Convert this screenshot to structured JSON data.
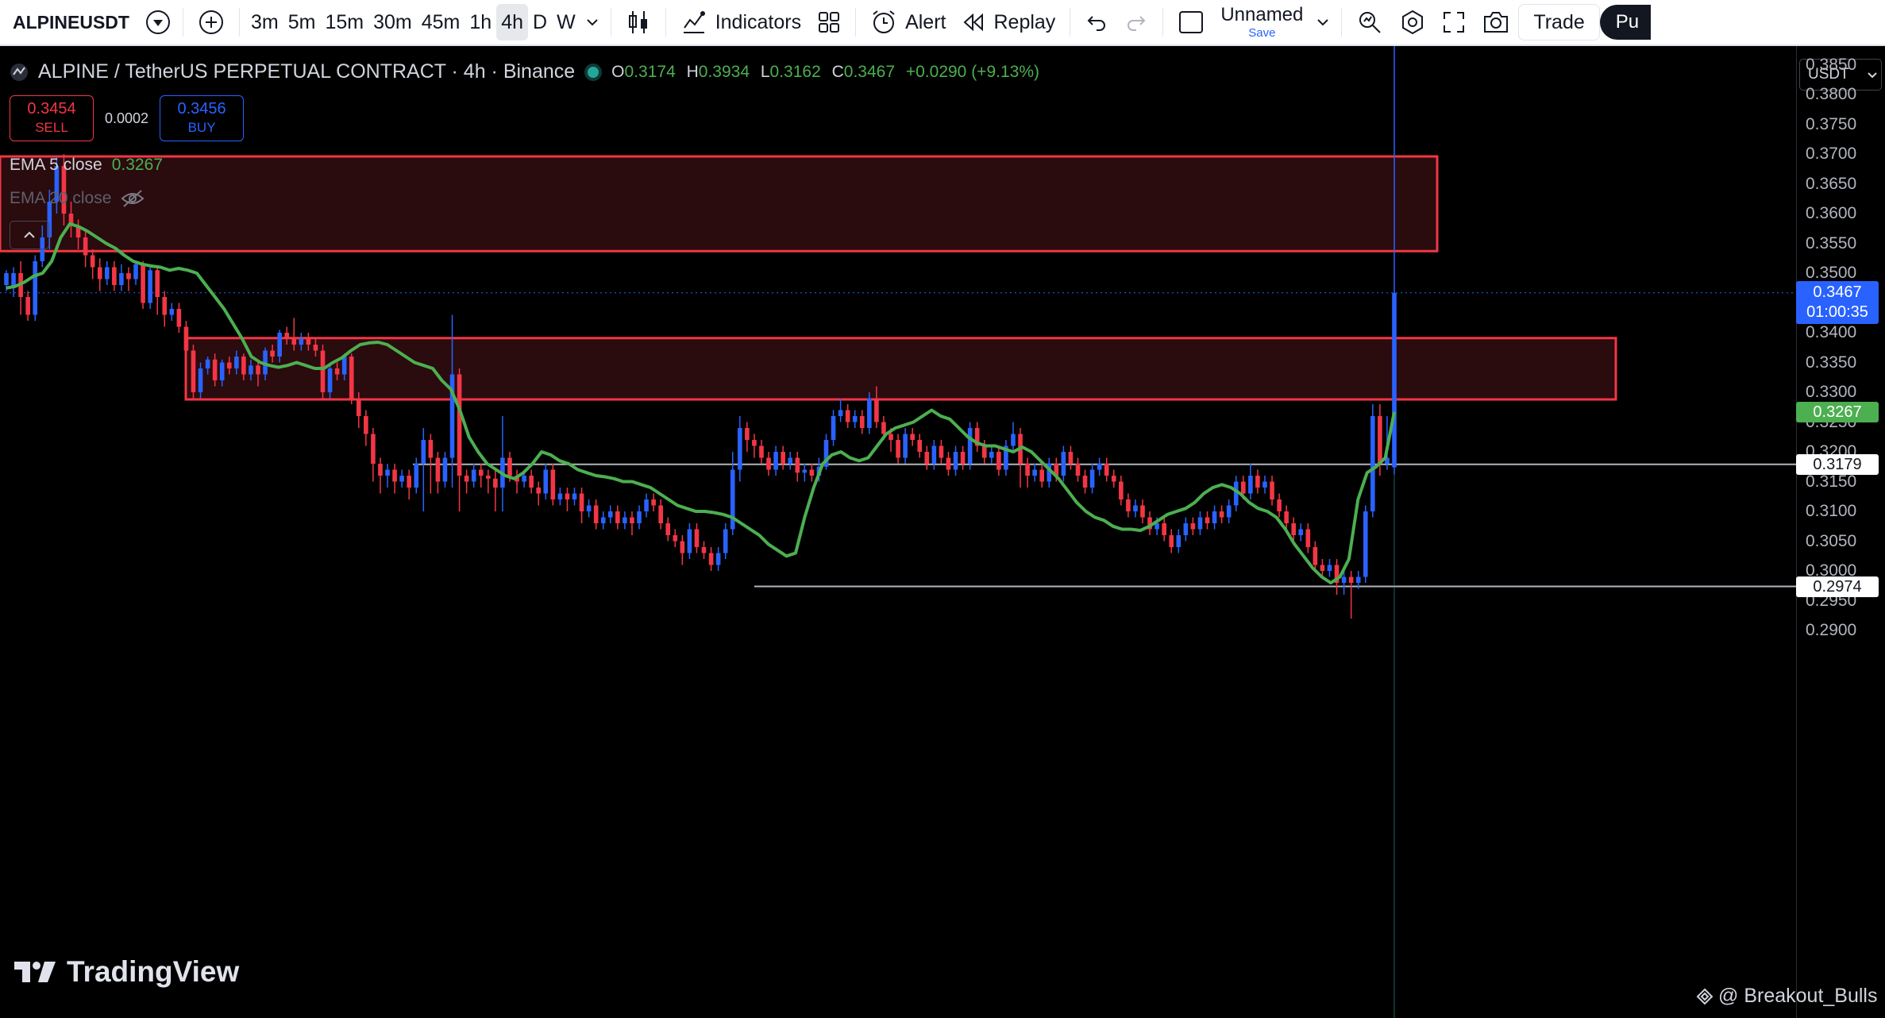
{
  "toolbar": {
    "symbol": "ALPINEUSDT",
    "intervals": [
      "3m",
      "5m",
      "15m",
      "30m",
      "45m",
      "1h",
      "4h",
      "D",
      "W"
    ],
    "active_interval": "4h",
    "indicators_label": "Indicators",
    "alert_label": "Alert",
    "replay_label": "Replay",
    "layout_name": "Unnamed",
    "layout_save": "Save",
    "trade_label": "Trade",
    "publish_label": "Pu"
  },
  "legend": {
    "title": "ALPINE / TetherUS PERPETUAL CONTRACT · 4h · Binance",
    "open_label": "O",
    "open": "0.3174",
    "high_label": "H",
    "high": "0.3934",
    "low_label": "L",
    "low": "0.3162",
    "close_label": "C",
    "close": "0.3467",
    "change": "+0.0290 (+9.13%)"
  },
  "ticket": {
    "sell_price": "0.3454",
    "sell_label": "SELL",
    "spread": "0.0002",
    "buy_price": "0.3456",
    "buy_label": "BUY"
  },
  "indicators": {
    "ema5_label": "EMA 5 close",
    "ema5_value": "0.3267",
    "ema20_label": "EMA 20 close"
  },
  "price_scale": {
    "currency": "USDT",
    "labels": [
      "0.3850",
      "0.3800",
      "0.3750",
      "0.3700",
      "0.3650",
      "0.3600",
      "0.3550",
      "0.3500",
      "0.3400",
      "0.3350",
      "0.3300",
      "0.3250",
      "0.3200",
      "0.3150",
      "0.3100",
      "0.3050",
      "0.3000",
      "0.2950",
      "0.2900"
    ],
    "last_price": "0.3467",
    "countdown": "01:00:35",
    "ema_tag": "0.3267",
    "level_1": "0.3179",
    "level_2": "0.2974"
  },
  "colors": {
    "up": "#2962ff",
    "down": "#f23645",
    "ema5": "#4caf50",
    "zone_fill": "#2a0b0e",
    "zone_border": "#f23645",
    "level_line": "#b2b5be"
  },
  "chart_data": {
    "type": "candlestick",
    "ylim": [
      0.2875,
      0.388
    ],
    "zones": [
      {
        "top": 0.3696,
        "bottom": 0.3537
      },
      {
        "top": 0.3391,
        "bottom": 0.3288
      }
    ],
    "horizontal_levels": [
      0.3179,
      0.2974
    ],
    "ema5": [
      0.3475,
      0.3478,
      0.3485,
      0.3495,
      0.35,
      0.352,
      0.356,
      0.3583,
      0.3578,
      0.357,
      0.356,
      0.355,
      0.3542,
      0.353,
      0.352,
      0.3515,
      0.3512,
      0.351,
      0.3505,
      0.3508,
      0.3505,
      0.35,
      0.348,
      0.346,
      0.344,
      0.3415,
      0.339,
      0.336,
      0.335,
      0.3345,
      0.3342,
      0.3345,
      0.335,
      0.3345,
      0.334,
      0.334,
      0.335,
      0.3358,
      0.337,
      0.338,
      0.3383,
      0.3384,
      0.338,
      0.337,
      0.336,
      0.335,
      0.3345,
      0.334,
      0.332,
      0.3305,
      0.327,
      0.3225,
      0.32,
      0.318,
      0.317,
      0.316,
      0.3155,
      0.3165,
      0.318,
      0.32,
      0.3195,
      0.3185,
      0.318,
      0.317,
      0.3165,
      0.316,
      0.3158,
      0.3155,
      0.315,
      0.315,
      0.3145,
      0.314,
      0.313,
      0.312,
      0.311,
      0.3105,
      0.31,
      0.31,
      0.3098,
      0.3095,
      0.309,
      0.308,
      0.307,
      0.306,
      0.3045,
      0.3035,
      0.3025,
      0.303,
      0.309,
      0.314,
      0.318,
      0.3195,
      0.32,
      0.319,
      0.3185,
      0.319,
      0.321,
      0.323,
      0.324,
      0.3245,
      0.325,
      0.326,
      0.327,
      0.326,
      0.3255,
      0.324,
      0.3225,
      0.3215,
      0.321,
      0.321,
      0.3205,
      0.32,
      0.3208,
      0.32,
      0.3185,
      0.317,
      0.3155,
      0.3135,
      0.3115,
      0.31,
      0.309,
      0.3085,
      0.3075,
      0.307,
      0.307,
      0.3068,
      0.3075,
      0.3085,
      0.3095,
      0.31,
      0.3105,
      0.3115,
      0.313,
      0.314,
      0.3145,
      0.314,
      0.313,
      0.3115,
      0.3105,
      0.31,
      0.309,
      0.307,
      0.3045,
      0.3025,
      0.3005,
      0.299,
      0.298,
      0.299,
      0.302,
      0.312,
      0.3165,
      0.3175,
      0.319,
      0.3267
    ],
    "candles": [
      [
        0.348,
        0.35,
        0.347,
        0.3505
      ],
      [
        0.3475,
        0.35,
        0.346,
        0.351
      ],
      [
        0.35,
        0.346,
        0.343,
        0.352
      ],
      [
        0.346,
        0.343,
        0.342,
        0.347
      ],
      [
        0.343,
        0.352,
        0.342,
        0.353
      ],
      [
        0.352,
        0.356,
        0.351,
        0.358
      ],
      [
        0.356,
        0.362,
        0.354,
        0.364
      ],
      [
        0.362,
        0.368,
        0.36,
        0.3695
      ],
      [
        0.368,
        0.36,
        0.358,
        0.37
      ],
      [
        0.36,
        0.358,
        0.356,
        0.362
      ],
      [
        0.358,
        0.356,
        0.354,
        0.359
      ],
      [
        0.356,
        0.353,
        0.351,
        0.3575
      ],
      [
        0.353,
        0.351,
        0.349,
        0.354
      ],
      [
        0.351,
        0.349,
        0.347,
        0.3525
      ],
      [
        0.349,
        0.351,
        0.348,
        0.352
      ],
      [
        0.351,
        0.348,
        0.347,
        0.352
      ],
      [
        0.348,
        0.35,
        0.347,
        0.3515
      ],
      [
        0.35,
        0.349,
        0.347,
        0.351
      ],
      [
        0.349,
        0.3515,
        0.348,
        0.352
      ],
      [
        0.3515,
        0.345,
        0.344,
        0.352
      ],
      [
        0.345,
        0.3505,
        0.344,
        0.351
      ],
      [
        0.3505,
        0.346,
        0.343,
        0.351
      ],
      [
        0.346,
        0.343,
        0.341,
        0.347
      ],
      [
        0.343,
        0.344,
        0.342,
        0.345
      ],
      [
        0.344,
        0.341,
        0.34,
        0.345
      ],
      [
        0.341,
        0.337,
        0.336,
        0.342
      ],
      [
        0.337,
        0.33,
        0.329,
        0.338
      ],
      [
        0.33,
        0.334,
        0.329,
        0.335
      ],
      [
        0.334,
        0.3355,
        0.333,
        0.336
      ],
      [
        0.3355,
        0.332,
        0.331,
        0.3365
      ],
      [
        0.332,
        0.335,
        0.331,
        0.3355
      ],
      [
        0.335,
        0.334,
        0.333,
        0.336
      ],
      [
        0.334,
        0.336,
        0.333,
        0.337
      ],
      [
        0.336,
        0.333,
        0.332,
        0.3365
      ],
      [
        0.333,
        0.3345,
        0.332,
        0.3355
      ],
      [
        0.3345,
        0.333,
        0.331,
        0.335
      ],
      [
        0.333,
        0.337,
        0.332,
        0.3375
      ],
      [
        0.337,
        0.336,
        0.335,
        0.338
      ],
      [
        0.336,
        0.34,
        0.335,
        0.3405
      ],
      [
        0.34,
        0.339,
        0.338,
        0.341
      ],
      [
        0.339,
        0.338,
        0.337,
        0.3425
      ],
      [
        0.338,
        0.339,
        0.337,
        0.34
      ],
      [
        0.339,
        0.338,
        0.337,
        0.34
      ],
      [
        0.338,
        0.337,
        0.336,
        0.339
      ],
      [
        0.337,
        0.33,
        0.329,
        0.338
      ],
      [
        0.33,
        0.334,
        0.329,
        0.335
      ],
      [
        0.334,
        0.333,
        0.332,
        0.335
      ],
      [
        0.333,
        0.336,
        0.332,
        0.3365
      ],
      [
        0.336,
        0.329,
        0.328,
        0.3365
      ],
      [
        0.329,
        0.326,
        0.324,
        0.33
      ],
      [
        0.326,
        0.323,
        0.321,
        0.327
      ],
      [
        0.323,
        0.318,
        0.315,
        0.324
      ],
      [
        0.318,
        0.316,
        0.313,
        0.319
      ],
      [
        0.316,
        0.317,
        0.314,
        0.318
      ],
      [
        0.317,
        0.315,
        0.313,
        0.318
      ],
      [
        0.315,
        0.316,
        0.314,
        0.317
      ],
      [
        0.316,
        0.314,
        0.312,
        0.317
      ],
      [
        0.314,
        0.318,
        0.313,
        0.319
      ],
      [
        0.318,
        0.322,
        0.31,
        0.324
      ],
      [
        0.322,
        0.319,
        0.313,
        0.323
      ],
      [
        0.319,
        0.315,
        0.313,
        0.32
      ],
      [
        0.315,
        0.319,
        0.314,
        0.32
      ],
      [
        0.319,
        0.333,
        0.314,
        0.343
      ],
      [
        0.333,
        0.316,
        0.31,
        0.334
      ],
      [
        0.316,
        0.315,
        0.313,
        0.317
      ],
      [
        0.315,
        0.317,
        0.314,
        0.318
      ],
      [
        0.317,
        0.316,
        0.314,
        0.318
      ],
      [
        0.316,
        0.3155,
        0.313,
        0.317
      ],
      [
        0.3155,
        0.314,
        0.31,
        0.317
      ],
      [
        0.314,
        0.319,
        0.31,
        0.326
      ],
      [
        0.319,
        0.316,
        0.315,
        0.32
      ],
      [
        0.316,
        0.315,
        0.313,
        0.317
      ],
      [
        0.315,
        0.316,
        0.314,
        0.317
      ],
      [
        0.316,
        0.314,
        0.313,
        0.317
      ],
      [
        0.314,
        0.313,
        0.311,
        0.315
      ],
      [
        0.313,
        0.317,
        0.312,
        0.318
      ],
      [
        0.317,
        0.312,
        0.311,
        0.318
      ],
      [
        0.312,
        0.313,
        0.311,
        0.314
      ],
      [
        0.313,
        0.312,
        0.31,
        0.314
      ],
      [
        0.312,
        0.313,
        0.311,
        0.314
      ],
      [
        0.313,
        0.31,
        0.308,
        0.314
      ],
      [
        0.31,
        0.311,
        0.309,
        0.312
      ],
      [
        0.311,
        0.308,
        0.307,
        0.312
      ],
      [
        0.308,
        0.309,
        0.307,
        0.31
      ],
      [
        0.309,
        0.31,
        0.308,
        0.311
      ],
      [
        0.31,
        0.308,
        0.307,
        0.311
      ],
      [
        0.308,
        0.309,
        0.307,
        0.31
      ],
      [
        0.309,
        0.308,
        0.306,
        0.31
      ],
      [
        0.308,
        0.31,
        0.307,
        0.311
      ],
      [
        0.31,
        0.312,
        0.309,
        0.313
      ],
      [
        0.312,
        0.311,
        0.31,
        0.313
      ],
      [
        0.311,
        0.308,
        0.307,
        0.312
      ],
      [
        0.308,
        0.306,
        0.305,
        0.309
      ],
      [
        0.306,
        0.305,
        0.304,
        0.307
      ],
      [
        0.305,
        0.303,
        0.301,
        0.306
      ],
      [
        0.303,
        0.307,
        0.302,
        0.308
      ],
      [
        0.307,
        0.304,
        0.303,
        0.308
      ],
      [
        0.304,
        0.303,
        0.302,
        0.305
      ],
      [
        0.303,
        0.301,
        0.3,
        0.304
      ],
      [
        0.301,
        0.303,
        0.3,
        0.304
      ],
      [
        0.303,
        0.307,
        0.302,
        0.308
      ],
      [
        0.307,
        0.317,
        0.306,
        0.32
      ],
      [
        0.317,
        0.324,
        0.315,
        0.326
      ],
      [
        0.324,
        0.322,
        0.32,
        0.325
      ],
      [
        0.322,
        0.321,
        0.319,
        0.323
      ],
      [
        0.321,
        0.319,
        0.318,
        0.322
      ],
      [
        0.319,
        0.317,
        0.316,
        0.32
      ],
      [
        0.317,
        0.32,
        0.316,
        0.321
      ],
      [
        0.32,
        0.318,
        0.317,
        0.321
      ],
      [
        0.318,
        0.319,
        0.317,
        0.32
      ],
      [
        0.319,
        0.3165,
        0.315,
        0.32
      ],
      [
        0.3165,
        0.317,
        0.315,
        0.318
      ],
      [
        0.317,
        0.316,
        0.315,
        0.318
      ],
      [
        0.316,
        0.3175,
        0.315,
        0.319
      ],
      [
        0.3175,
        0.322,
        0.317,
        0.323
      ],
      [
        0.322,
        0.326,
        0.321,
        0.327
      ],
      [
        0.326,
        0.327,
        0.325,
        0.329
      ],
      [
        0.327,
        0.325,
        0.324,
        0.328
      ],
      [
        0.325,
        0.326,
        0.324,
        0.327
      ],
      [
        0.326,
        0.324,
        0.323,
        0.327
      ],
      [
        0.324,
        0.329,
        0.323,
        0.33
      ],
      [
        0.329,
        0.325,
        0.324,
        0.331
      ],
      [
        0.325,
        0.323,
        0.322,
        0.326
      ],
      [
        0.323,
        0.322,
        0.32,
        0.324
      ],
      [
        0.322,
        0.319,
        0.318,
        0.323
      ],
      [
        0.319,
        0.323,
        0.318,
        0.324
      ],
      [
        0.323,
        0.322,
        0.321,
        0.324
      ],
      [
        0.322,
        0.32,
        0.319,
        0.323
      ],
      [
        0.32,
        0.318,
        0.317,
        0.321
      ],
      [
        0.318,
        0.321,
        0.317,
        0.322
      ],
      [
        0.321,
        0.319,
        0.318,
        0.322
      ],
      [
        0.319,
        0.317,
        0.316,
        0.32
      ],
      [
        0.317,
        0.32,
        0.316,
        0.321
      ],
      [
        0.32,
        0.318,
        0.317,
        0.321
      ],
      [
        0.318,
        0.324,
        0.317,
        0.325
      ],
      [
        0.324,
        0.321,
        0.32,
        0.325
      ],
      [
        0.321,
        0.319,
        0.318,
        0.322
      ],
      [
        0.319,
        0.32,
        0.318,
        0.321
      ],
      [
        0.32,
        0.317,
        0.316,
        0.321
      ],
      [
        0.317,
        0.321,
        0.316,
        0.322
      ],
      [
        0.321,
        0.323,
        0.32,
        0.325
      ],
      [
        0.323,
        0.318,
        0.314,
        0.324
      ],
      [
        0.318,
        0.316,
        0.314,
        0.319
      ],
      [
        0.316,
        0.317,
        0.315,
        0.318
      ],
      [
        0.317,
        0.315,
        0.314,
        0.318
      ],
      [
        0.315,
        0.318,
        0.314,
        0.319
      ],
      [
        0.318,
        0.316,
        0.315,
        0.319
      ],
      [
        0.316,
        0.32,
        0.315,
        0.321
      ],
      [
        0.32,
        0.318,
        0.317,
        0.321
      ],
      [
        0.318,
        0.316,
        0.315,
        0.319
      ],
      [
        0.316,
        0.314,
        0.313,
        0.317
      ],
      [
        0.314,
        0.317,
        0.313,
        0.318
      ],
      [
        0.317,
        0.318,
        0.316,
        0.319
      ],
      [
        0.318,
        0.316,
        0.315,
        0.319
      ],
      [
        0.316,
        0.315,
        0.314,
        0.317
      ],
      [
        0.315,
        0.312,
        0.311,
        0.316
      ],
      [
        0.312,
        0.31,
        0.309,
        0.313
      ],
      [
        0.31,
        0.311,
        0.309,
        0.312
      ],
      [
        0.311,
        0.309,
        0.308,
        0.312
      ],
      [
        0.309,
        0.307,
        0.306,
        0.31
      ],
      [
        0.307,
        0.308,
        0.306,
        0.309
      ],
      [
        0.308,
        0.306,
        0.305,
        0.309
      ],
      [
        0.306,
        0.304,
        0.303,
        0.307
      ],
      [
        0.304,
        0.306,
        0.303,
        0.307
      ],
      [
        0.306,
        0.308,
        0.305,
        0.309
      ],
      [
        0.308,
        0.307,
        0.306,
        0.309
      ],
      [
        0.307,
        0.309,
        0.306,
        0.31
      ],
      [
        0.309,
        0.308,
        0.307,
        0.31
      ],
      [
        0.308,
        0.31,
        0.307,
        0.311
      ],
      [
        0.31,
        0.309,
        0.308,
        0.311
      ],
      [
        0.309,
        0.311,
        0.308,
        0.312
      ],
      [
        0.311,
        0.315,
        0.31,
        0.316
      ],
      [
        0.315,
        0.313,
        0.312,
        0.316
      ],
      [
        0.313,
        0.316,
        0.312,
        0.318
      ],
      [
        0.316,
        0.314,
        0.313,
        0.317
      ],
      [
        0.314,
        0.315,
        0.313,
        0.316
      ],
      [
        0.315,
        0.312,
        0.311,
        0.316
      ],
      [
        0.312,
        0.31,
        0.309,
        0.313
      ],
      [
        0.31,
        0.308,
        0.307,
        0.311
      ],
      [
        0.308,
        0.306,
        0.305,
        0.309
      ],
      [
        0.306,
        0.307,
        0.305,
        0.308
      ],
      [
        0.307,
        0.304,
        0.303,
        0.308
      ],
      [
        0.304,
        0.301,
        0.3,
        0.305
      ],
      [
        0.301,
        0.3,
        0.299,
        0.302
      ],
      [
        0.3,
        0.301,
        0.299,
        0.302
      ],
      [
        0.301,
        0.298,
        0.296,
        0.302
      ],
      [
        0.298,
        0.299,
        0.296,
        0.3
      ],
      [
        0.299,
        0.298,
        0.292,
        0.3
      ],
      [
        0.298,
        0.299,
        0.297,
        0.3
      ],
      [
        0.299,
        0.31,
        0.298,
        0.311
      ],
      [
        0.31,
        0.326,
        0.309,
        0.328
      ],
      [
        0.326,
        0.318,
        0.316,
        0.328
      ],
      [
        0.318,
        0.319,
        0.317,
        0.326
      ],
      [
        0.3174,
        0.3467,
        0.3162,
        0.3934
      ]
    ]
  }
}
